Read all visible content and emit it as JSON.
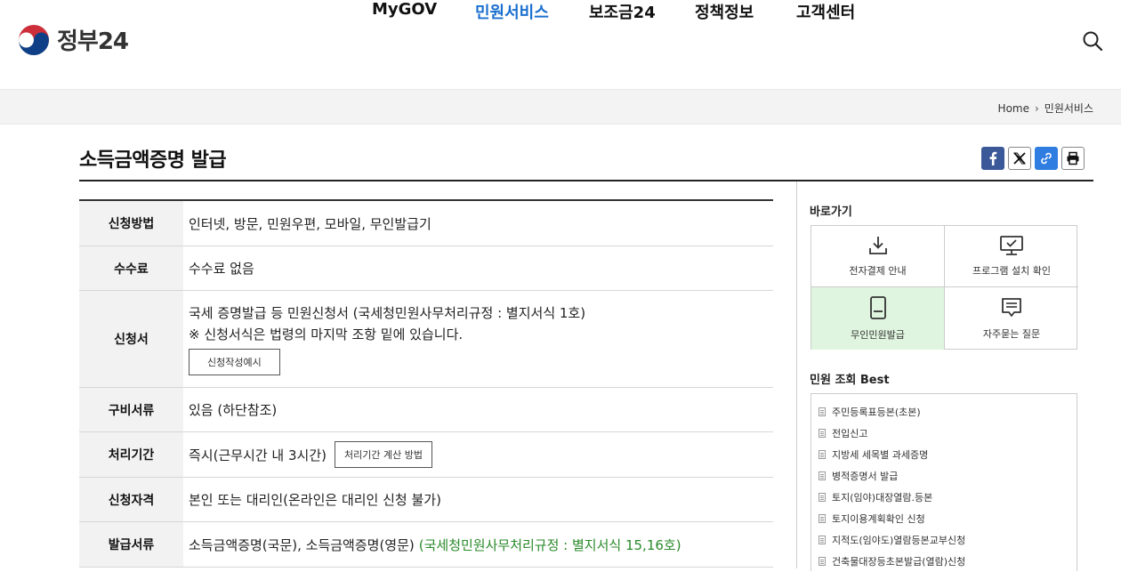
{
  "header": {
    "logo_text": "정부24",
    "nav": [
      {
        "label": "MyGOV",
        "active": false
      },
      {
        "label": "민원서비스",
        "active": true
      },
      {
        "label": "보조금24",
        "active": false
      },
      {
        "label": "정책정보",
        "active": false
      },
      {
        "label": "고객센터",
        "active": false
      }
    ],
    "search_icon": "search-icon"
  },
  "breadcrumb": {
    "home": "Home",
    "current": "민원서비스"
  },
  "page_title": "소득금액증명 발급",
  "share": [
    "facebook-icon",
    "x-icon",
    "link-icon",
    "print-icon"
  ],
  "info_rows": [
    {
      "label": "신청방법",
      "value": "인터넷, 방문, 민원우편, 모바일, 무인발급기"
    },
    {
      "label": "수수료",
      "value": "수수료 없음"
    },
    {
      "label": "신청서",
      "line1": "국세 증명발급 등 민원신청서 (국세청민원사무처리규정 : 별지서식 1호)",
      "line2": "※ 신청서식은 법령의 마지막 조항 밑에 있습니다.",
      "button": "신청작성예시"
    },
    {
      "label": "구비서류",
      "value": "있음 (하단참조)"
    },
    {
      "label": "처리기간",
      "value": "즉시(근무시간 내 3시간)",
      "button": "처리기간 계산 방법"
    },
    {
      "label": "신청자격",
      "value": "본인 또는 대리인(온라인은 대리인 신청 불가)"
    },
    {
      "label": "발급서류",
      "value": "소득금액증명(국문), 소득금액증명(영문)",
      "extra": "(국세청민원사무처리규정 : 별지서식 15,16호)"
    }
  ],
  "sidebar": {
    "quick_title": "바로가기",
    "quick_links": [
      {
        "label": "전자결제 안내",
        "icon": "download-icon"
      },
      {
        "label": "프로그램 설치 확인",
        "icon": "monitor-check-icon"
      },
      {
        "label": "무인민원발급",
        "icon": "kiosk-icon"
      },
      {
        "label": "자주묻는 질문",
        "icon": "chat-icon"
      }
    ],
    "best_title": "민원 조회 Best",
    "best_items": [
      "주민등록표등본(초본)",
      "전입신고",
      "지방세 세목별 과세증명",
      "병적증명서 발급",
      "토지(임야)대장열람.등본",
      "토지이용계획확인 신청",
      "지적도(임야도)열람등본교부신청",
      "건축물대장등초본발급(열람)신청"
    ]
  },
  "colors": {
    "accent": "#1a6fcf",
    "highlight_green": "#dff5df",
    "green_text": "#2a8a2a"
  }
}
